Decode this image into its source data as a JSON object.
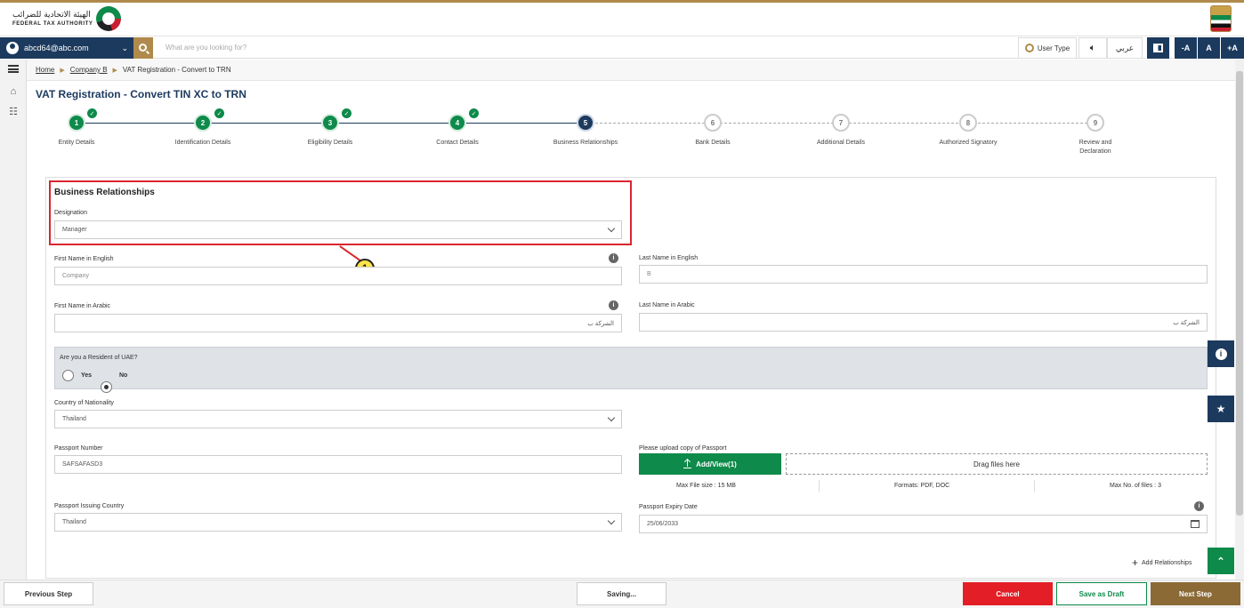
{
  "header": {
    "logo_arabic": "الهيئة الاتحادية للضرائب",
    "logo_english": "FEDERAL TAX AUTHORITY"
  },
  "topnav": {
    "user_email": "abcd64@abc.com",
    "search_placeholder": "What are you looking for?",
    "user_type_label": "User Type",
    "language_label": "عربي",
    "font_decrease": "-A",
    "font_normal": "A",
    "font_increase": "+A"
  },
  "breadcrumb": {
    "home": "Home",
    "company": "Company B",
    "current": "VAT Registration - Convert to TRN"
  },
  "page_title": "VAT Registration - Convert TIN XC to TRN",
  "steps": [
    {
      "number": "1",
      "label": "Entity Details",
      "state": "done"
    },
    {
      "number": "2",
      "label": "Identification Details",
      "state": "done"
    },
    {
      "number": "3",
      "label": "Eligibility Details",
      "state": "done"
    },
    {
      "number": "4",
      "label": "Contact Details",
      "state": "done"
    },
    {
      "number": "5",
      "label": "Business Relationships",
      "state": "current"
    },
    {
      "number": "6",
      "label": "Bank Details",
      "state": "todo"
    },
    {
      "number": "7",
      "label": "Additional Details",
      "state": "todo"
    },
    {
      "number": "8",
      "label": "Authorized Signatory",
      "state": "todo"
    },
    {
      "number": "9",
      "label": "Review and Declaration",
      "state": "todo"
    }
  ],
  "form": {
    "section_title": "Business Relationships",
    "designation_label": "Designation",
    "designation_value": "Manager",
    "first_name_en_label": "First Name in English",
    "first_name_en_value": "Company",
    "last_name_en_label": "Last Name in English",
    "last_name_en_value": "B",
    "first_name_ar_label": "First Name in Arabic",
    "first_name_ar_value": "الشركة ب",
    "last_name_ar_label": "Last Name in Arabic",
    "last_name_ar_value": "الشركة ب",
    "resident_question": "Are you a Resident of UAE?",
    "resident_yes": "Yes",
    "resident_no": "No",
    "nationality_label": "Country of Nationality",
    "nationality_value": "Thailand",
    "passport_number_label": "Passport Number",
    "passport_number_value": "SAFSAFASD3",
    "passport_upload_label": "Please upload copy of Passport",
    "upload_button": "Add/View(1)",
    "drag_text": "Drag files here",
    "max_file_size": "Max File size : 15 MB",
    "formats": "Formats: PDF, DOC",
    "max_files": "Max No. of files : 3",
    "issuing_country_label": "Passport Issuing Country",
    "issuing_country_value": "Thailand",
    "expiry_label": "Passport Expiry Date",
    "expiry_value": "25/06/2033",
    "add_relationships": "Add Relationships"
  },
  "annotation": {
    "callout_number": "1"
  },
  "footer": {
    "previous": "Previous Step",
    "saving": "Saving...",
    "cancel": "Cancel",
    "save_draft": "Save as Draft",
    "next": "Next Step"
  },
  "colors": {
    "navy": "#1c3a5e",
    "green": "#0e8a4a",
    "gold": "#b08a4c",
    "red": "#e31e26"
  }
}
